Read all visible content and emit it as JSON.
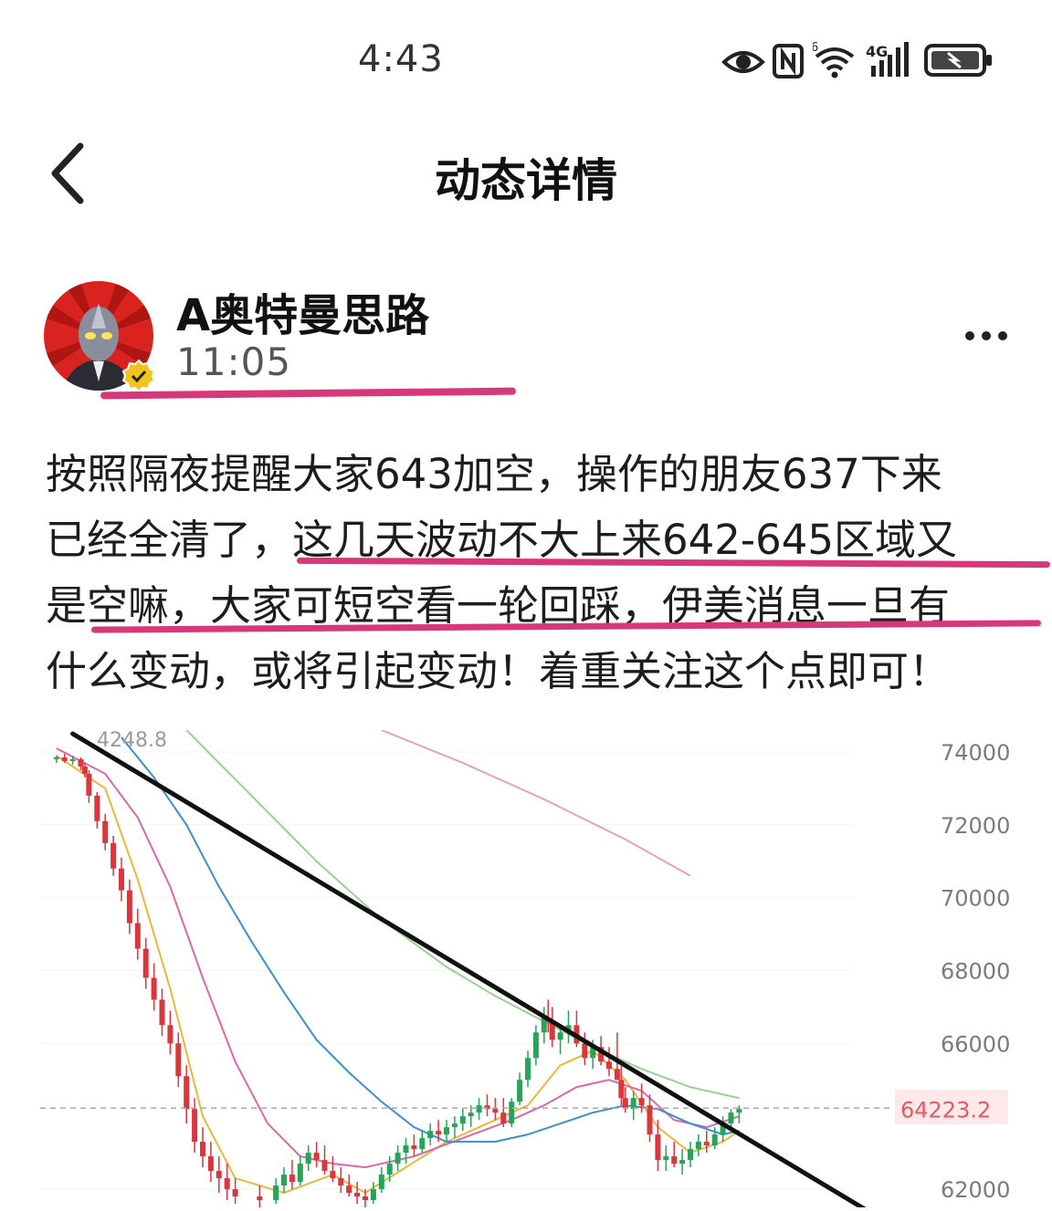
{
  "status_bar": {
    "time": "4:43",
    "icons": [
      "eye-icon",
      "nfc-icon",
      "wifi-icon",
      "signal-4g-icon",
      "battery-icon"
    ],
    "network_label": "4G",
    "wifi_label": "6"
  },
  "header": {
    "title": "动态详情",
    "back_icon": "chevron-left-icon"
  },
  "post": {
    "author": "A奥特曼思路",
    "time": "11:05",
    "verified": true,
    "more_icon": "more-dots-icon",
    "lines": [
      "按照隔夜提醒大家643加空，操作的朋友637下来",
      "已经全清了，这几天波动不大上来642-645区域又",
      "是空嘛，大家可短空看一轮回踩，伊美消息一旦有",
      "什么变动，或将引起变动！着重关注这个点即可！"
    ]
  },
  "colors": {
    "highlight": "#d6387a",
    "bull": "#27a35a",
    "bear": "#d9363e",
    "ma_yellow": "#e9b83a",
    "ma_pink": "#d86aa8",
    "ma_blue": "#3f8fc9",
    "ma_green": "#9ccf94",
    "ma_rose": "#e3a4b4"
  },
  "chart_data": {
    "type": "candlestick",
    "y_ticks": [
      74000,
      72000,
      70000,
      68000,
      66000,
      62000
    ],
    "current_price": "64223.2",
    "high_marker": "4248.8",
    "ylim": [
      61500,
      74600
    ],
    "trendline": [
      [
        0.04,
        74500
      ],
      [
        0.91,
        62850
      ]
    ],
    "candles": [
      [
        0.02,
        73800,
        73900,
        73700,
        73850
      ],
      [
        0.03,
        73850,
        73950,
        73700,
        73750
      ],
      [
        0.04,
        73750,
        73900,
        73650,
        73800
      ],
      [
        0.05,
        73800,
        73850,
        73500,
        73600
      ],
      [
        0.055,
        73600,
        73700,
        73300,
        73400
      ],
      [
        0.06,
        73400,
        73500,
        72600,
        72800
      ],
      [
        0.07,
        72800,
        72900,
        71900,
        72100
      ],
      [
        0.08,
        72100,
        72300,
        71300,
        71500
      ],
      [
        0.09,
        71500,
        71700,
        70600,
        70800
      ],
      [
        0.1,
        70800,
        71100,
        69900,
        70200
      ],
      [
        0.11,
        70200,
        70500,
        69000,
        69300
      ],
      [
        0.12,
        69300,
        69700,
        68300,
        68600
      ],
      [
        0.13,
        68600,
        68900,
        67500,
        67800
      ],
      [
        0.14,
        67800,
        68200,
        66900,
        67200
      ],
      [
        0.15,
        67200,
        67500,
        66200,
        66500
      ],
      [
        0.16,
        66500,
        66900,
        65700,
        66000
      ],
      [
        0.17,
        66000,
        66300,
        64800,
        65100
      ],
      [
        0.18,
        65100,
        65400,
        63800,
        64200
      ],
      [
        0.19,
        64200,
        64500,
        63000,
        63300
      ],
      [
        0.2,
        63300,
        63700,
        62600,
        62900
      ],
      [
        0.21,
        62900,
        63300,
        62200,
        62500
      ],
      [
        0.22,
        62500,
        62900,
        61900,
        62300
      ],
      [
        0.23,
        62300,
        62700,
        61700,
        62000
      ],
      [
        0.24,
        62000,
        62300,
        61600,
        61800
      ],
      [
        0.27,
        61800,
        62100,
        61500,
        61700
      ],
      [
        0.29,
        61700,
        62300,
        61600,
        62100
      ],
      [
        0.3,
        62100,
        62600,
        61900,
        62400
      ],
      [
        0.31,
        62400,
        62800,
        62000,
        62200
      ],
      [
        0.32,
        62200,
        62900,
        62100,
        62700
      ],
      [
        0.33,
        62700,
        63200,
        62500,
        63000
      ],
      [
        0.34,
        63000,
        63300,
        62600,
        62800
      ],
      [
        0.35,
        62800,
        63200,
        62400,
        62500
      ],
      [
        0.36,
        62500,
        62900,
        62200,
        62300
      ],
      [
        0.37,
        62300,
        62600,
        61900,
        62100
      ],
      [
        0.38,
        62100,
        62400,
        61800,
        61900
      ],
      [
        0.39,
        61900,
        62200,
        61600,
        61800
      ],
      [
        0.4,
        61800,
        62000,
        61500,
        61700
      ],
      [
        0.41,
        61700,
        62200,
        61600,
        62000
      ],
      [
        0.42,
        62000,
        62600,
        61900,
        62400
      ],
      [
        0.43,
        62400,
        62900,
        62200,
        62700
      ],
      [
        0.44,
        62700,
        63200,
        62500,
        63000
      ],
      [
        0.45,
        63000,
        63400,
        62700,
        63200
      ],
      [
        0.46,
        63200,
        63500,
        62900,
        63100
      ],
      [
        0.47,
        63100,
        63600,
        63000,
        63400
      ],
      [
        0.48,
        63400,
        63800,
        63200,
        63600
      ],
      [
        0.49,
        63600,
        63900,
        63300,
        63500
      ],
      [
        0.5,
        63500,
        63900,
        63300,
        63700
      ],
      [
        0.51,
        63700,
        64000,
        63400,
        63800
      ],
      [
        0.52,
        63800,
        64200,
        63600,
        64000
      ],
      [
        0.53,
        64000,
        64300,
        63700,
        64100
      ],
      [
        0.54,
        64100,
        64500,
        63900,
        64300
      ],
      [
        0.55,
        64300,
        64600,
        64000,
        64200
      ],
      [
        0.56,
        64200,
        64500,
        63900,
        64100
      ],
      [
        0.57,
        64100,
        64500,
        63700,
        63800
      ],
      [
        0.58,
        63800,
        64500,
        63700,
        64400
      ],
      [
        0.59,
        64400,
        65200,
        64300,
        65000
      ],
      [
        0.6,
        65000,
        65800,
        64800,
        65600
      ],
      [
        0.61,
        65600,
        66500,
        65400,
        66300
      ],
      [
        0.62,
        66300,
        67000,
        66000,
        66700
      ],
      [
        0.625,
        66700,
        67200,
        66300,
        66600
      ],
      [
        0.63,
        66600,
        67000,
        65900,
        66100
      ],
      [
        0.64,
        66100,
        66500,
        65700,
        66300
      ],
      [
        0.65,
        66300,
        66900,
        66000,
        66500
      ],
      [
        0.66,
        66500,
        66900,
        65900,
        66000
      ],
      [
        0.67,
        66000,
        66300,
        65400,
        65600
      ],
      [
        0.68,
        65600,
        66100,
        65300,
        65900
      ],
      [
        0.69,
        65900,
        66200,
        65400,
        65500
      ],
      [
        0.7,
        65500,
        65900,
        65100,
        65300
      ],
      [
        0.71,
        65300,
        66300,
        65000,
        65000
      ],
      [
        0.715,
        65000,
        65400,
        64300,
        64500
      ],
      [
        0.72,
        64500,
        64800,
        64100,
        64200
      ],
      [
        0.73,
        64200,
        64700,
        63900,
        64500
      ],
      [
        0.74,
        64500,
        64900,
        64100,
        64300
      ],
      [
        0.75,
        64300,
        64600,
        63300,
        63500
      ],
      [
        0.76,
        63500,
        63900,
        62500,
        62800
      ],
      [
        0.77,
        62800,
        63200,
        62500,
        62900
      ],
      [
        0.78,
        62900,
        63300,
        62600,
        62700
      ],
      [
        0.79,
        62700,
        63100,
        62400,
        62800
      ],
      [
        0.8,
        62800,
        63300,
        62600,
        63100
      ],
      [
        0.81,
        63100,
        63500,
        62900,
        63300
      ],
      [
        0.82,
        63300,
        63600,
        63000,
        63200
      ],
      [
        0.83,
        63200,
        63700,
        63100,
        63500
      ],
      [
        0.84,
        63500,
        64000,
        63300,
        63800
      ],
      [
        0.85,
        63800,
        64200,
        63600,
        64100
      ],
      [
        0.86,
        64100,
        64300,
        63800,
        64200
      ]
    ],
    "ma_lines": [
      {
        "color": "#e9b83a",
        "points": [
          [
            0.02,
            73900
          ],
          [
            0.08,
            73000
          ],
          [
            0.12,
            70500
          ],
          [
            0.16,
            67500
          ],
          [
            0.2,
            64000
          ],
          [
            0.24,
            62300
          ],
          [
            0.3,
            61900
          ],
          [
            0.36,
            62400
          ],
          [
            0.4,
            61900
          ],
          [
            0.45,
            62600
          ],
          [
            0.5,
            63300
          ],
          [
            0.56,
            63900
          ],
          [
            0.6,
            64300
          ],
          [
            0.64,
            65400
          ],
          [
            0.68,
            65800
          ],
          [
            0.72,
            65000
          ],
          [
            0.76,
            63700
          ],
          [
            0.8,
            63000
          ],
          [
            0.84,
            63300
          ],
          [
            0.86,
            63600
          ]
        ]
      },
      {
        "color": "#d86aa8",
        "points": [
          [
            0.02,
            74100
          ],
          [
            0.08,
            73400
          ],
          [
            0.12,
            72200
          ],
          [
            0.16,
            70300
          ],
          [
            0.2,
            67800
          ],
          [
            0.24,
            65500
          ],
          [
            0.28,
            63800
          ],
          [
            0.32,
            62900
          ],
          [
            0.36,
            62700
          ],
          [
            0.4,
            62600
          ],
          [
            0.46,
            62900
          ],
          [
            0.52,
            63400
          ],
          [
            0.58,
            63900
          ],
          [
            0.62,
            64300
          ],
          [
            0.66,
            64800
          ],
          [
            0.7,
            65000
          ],
          [
            0.74,
            64700
          ],
          [
            0.78,
            63900
          ],
          [
            0.82,
            63700
          ],
          [
            0.86,
            64000
          ]
        ]
      },
      {
        "color": "#3f8fc9",
        "points": [
          [
            0.1,
            74400
          ],
          [
            0.14,
            73300
          ],
          [
            0.18,
            72000
          ],
          [
            0.22,
            70300
          ],
          [
            0.26,
            68800
          ],
          [
            0.3,
            67400
          ],
          [
            0.34,
            66100
          ],
          [
            0.38,
            65200
          ],
          [
            0.42,
            64400
          ],
          [
            0.46,
            63700
          ],
          [
            0.5,
            63300
          ],
          [
            0.56,
            63300
          ],
          [
            0.6,
            63500
          ],
          [
            0.64,
            63800
          ],
          [
            0.68,
            64100
          ],
          [
            0.72,
            64300
          ],
          [
            0.76,
            64200
          ],
          [
            0.8,
            63800
          ],
          [
            0.84,
            63500
          ],
          [
            0.86,
            63600
          ]
        ]
      },
      {
        "color": "#9ccf94",
        "points": [
          [
            0.18,
            74600
          ],
          [
            0.26,
            72800
          ],
          [
            0.34,
            71000
          ],
          [
            0.42,
            69400
          ],
          [
            0.5,
            68100
          ],
          [
            0.56,
            67300
          ],
          [
            0.62,
            66600
          ],
          [
            0.68,
            65900
          ],
          [
            0.74,
            65300
          ],
          [
            0.8,
            64800
          ],
          [
            0.86,
            64500
          ]
        ]
      },
      {
        "color": "#e3a4b4",
        "points": [
          [
            0.42,
            74600
          ],
          [
            0.52,
            73700
          ],
          [
            0.62,
            72700
          ],
          [
            0.72,
            71600
          ],
          [
            0.8,
            70600
          ]
        ]
      }
    ]
  }
}
